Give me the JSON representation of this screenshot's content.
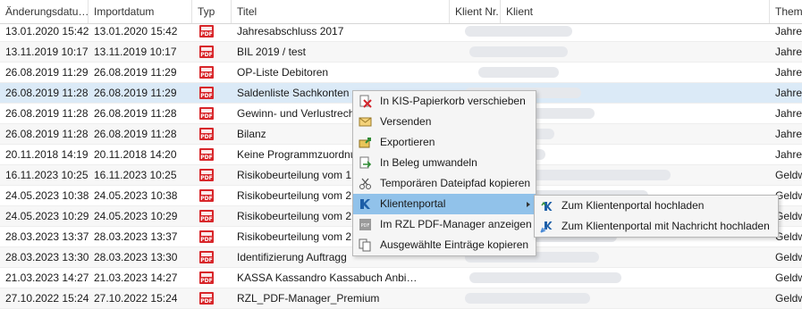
{
  "columns": {
    "aenderung": "Änderungsdatu…",
    "import": "Importdatum",
    "typ": "Typ",
    "titel": "Titel",
    "klientnr": "Klient Nr.",
    "klient": "Klient",
    "thema": "Thema"
  },
  "rows": [
    {
      "aend": "13.01.2020 15:42",
      "imp": "13.01.2020 15:42",
      "type": "PDF",
      "title": "Jahresabschluss 2017",
      "thema": "Jahres"
    },
    {
      "aend": "13.11.2019 10:17",
      "imp": "13.11.2019 10:17",
      "type": "PDF",
      "title": "BIL 2019 / test",
      "thema": "Jahres"
    },
    {
      "aend": "26.08.2019 11:29",
      "imp": "26.08.2019 11:29",
      "type": "PDF",
      "title": "OP-Liste Debitoren",
      "thema": "Jahres"
    },
    {
      "aend": "26.08.2019 11:28",
      "imp": "26.08.2019 11:29",
      "type": "PDF",
      "title": "Saldenliste Sachkonten",
      "thema": "Jahres"
    },
    {
      "aend": "26.08.2019 11:28",
      "imp": "26.08.2019 11:28",
      "type": "PDF",
      "title": "Gewinn- und Verlustrech",
      "thema": "Jahres"
    },
    {
      "aend": "26.08.2019 11:28",
      "imp": "26.08.2019 11:28",
      "type": "PDF",
      "title": "Bilanz",
      "thema": "Jahres"
    },
    {
      "aend": "20.11.2018 14:19",
      "imp": "20.11.2018 14:20",
      "type": "PDF",
      "title": "Keine Programmzuordnu",
      "thema": "Jahres"
    },
    {
      "aend": "16.11.2023 10:25",
      "imp": "16.11.2023 10:25",
      "type": "PDF",
      "title": "Risikobeurteilung vom 1",
      "thema": "Geldw"
    },
    {
      "aend": "24.05.2023 10:38",
      "imp": "24.05.2023 10:38",
      "type": "PDF",
      "title": "Risikobeurteilung vom 2",
      "thema": "Geldw"
    },
    {
      "aend": "24.05.2023 10:29",
      "imp": "24.05.2023 10:29",
      "type": "PDF",
      "title": "Risikobeurteilung vom 2",
      "thema": "Geldw"
    },
    {
      "aend": "28.03.2023 13:37",
      "imp": "28.03.2023 13:37",
      "type": "PDF",
      "title": "Risikobeurteilung vom 2",
      "thema": "Geldw"
    },
    {
      "aend": "28.03.2023 13:30",
      "imp": "28.03.2023 13:30",
      "type": "PDF",
      "title": "Identifizierung Auftragg",
      "thema": "Geldw"
    },
    {
      "aend": "21.03.2023 14:27",
      "imp": "21.03.2023 14:27",
      "type": "PDF",
      "title": "KASSA Kassandro Kassabuch Anbi…",
      "thema": "Geldw"
    },
    {
      "aend": "27.10.2022 15:24",
      "imp": "27.10.2022 15:24",
      "type": "PDF",
      "title": "RZL_PDF-Manager_Premium",
      "thema": "Geldw"
    }
  ],
  "context_menu": {
    "items": [
      {
        "label": "In KIS-Papierkorb verschieben",
        "icon": "recycle-delete-icon"
      },
      {
        "label": "Versenden",
        "icon": "send-mail-icon"
      },
      {
        "label": "Exportieren",
        "icon": "export-icon"
      },
      {
        "label": "In Beleg umwandeln",
        "icon": "convert-document-icon"
      },
      {
        "label": "Temporären Dateipfad kopieren",
        "icon": "copy-path-icon"
      },
      {
        "label": "Klientenportal",
        "icon": "client-portal-icon"
      },
      {
        "label": "Im RZL PDF-Manager anzeigen",
        "icon": "pdf-manager-icon"
      },
      {
        "label": "Ausgewählte Einträge kopieren",
        "icon": "copy-entries-icon"
      }
    ],
    "highlighted_index": 5
  },
  "submenu": {
    "items": [
      {
        "label": "Zum Klientenportal hochladen",
        "icon": "portal-upload-icon"
      },
      {
        "label": "Zum Klientenportal mit Nachricht hochladen",
        "icon": "portal-upload-message-icon"
      }
    ]
  },
  "colors": {
    "selection": "#dbeaf7",
    "menu_highlight": "#91c2ea",
    "pdf_red": "#d8262a"
  }
}
